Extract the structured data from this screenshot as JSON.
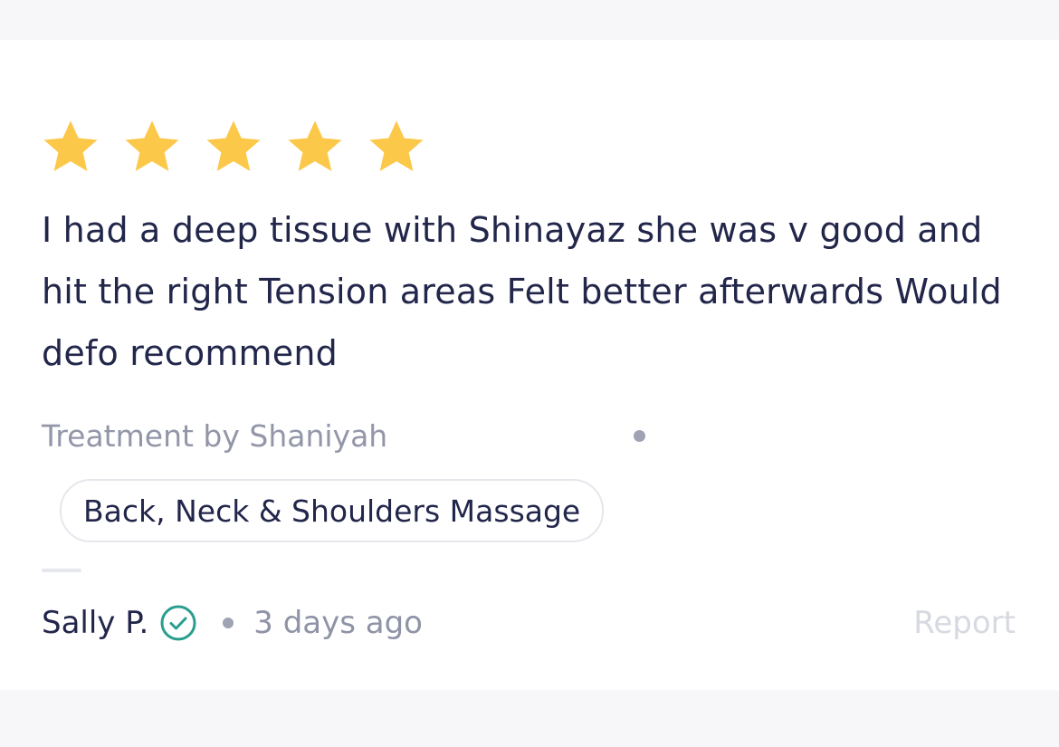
{
  "review": {
    "rating": 5,
    "rating_max": 5,
    "text": "I had a deep tissue with Shinayaz she was v good and hit the right Tension areas Felt better afterwards Would defo recommend",
    "treatment_by": "Treatment by Shaniyah",
    "service": "Back, Neck & Shoulders Massage",
    "reviewer": "Sally P.",
    "date": "3 days ago",
    "report_label": "Report"
  },
  "icons": {
    "star": "star-icon",
    "verified": "verified-check-icon"
  },
  "colors": {
    "star": "#fcc84a",
    "text": "#22264a",
    "muted": "#9296a8",
    "verified": "#2a9d8f",
    "report": "#d7d9e1"
  }
}
